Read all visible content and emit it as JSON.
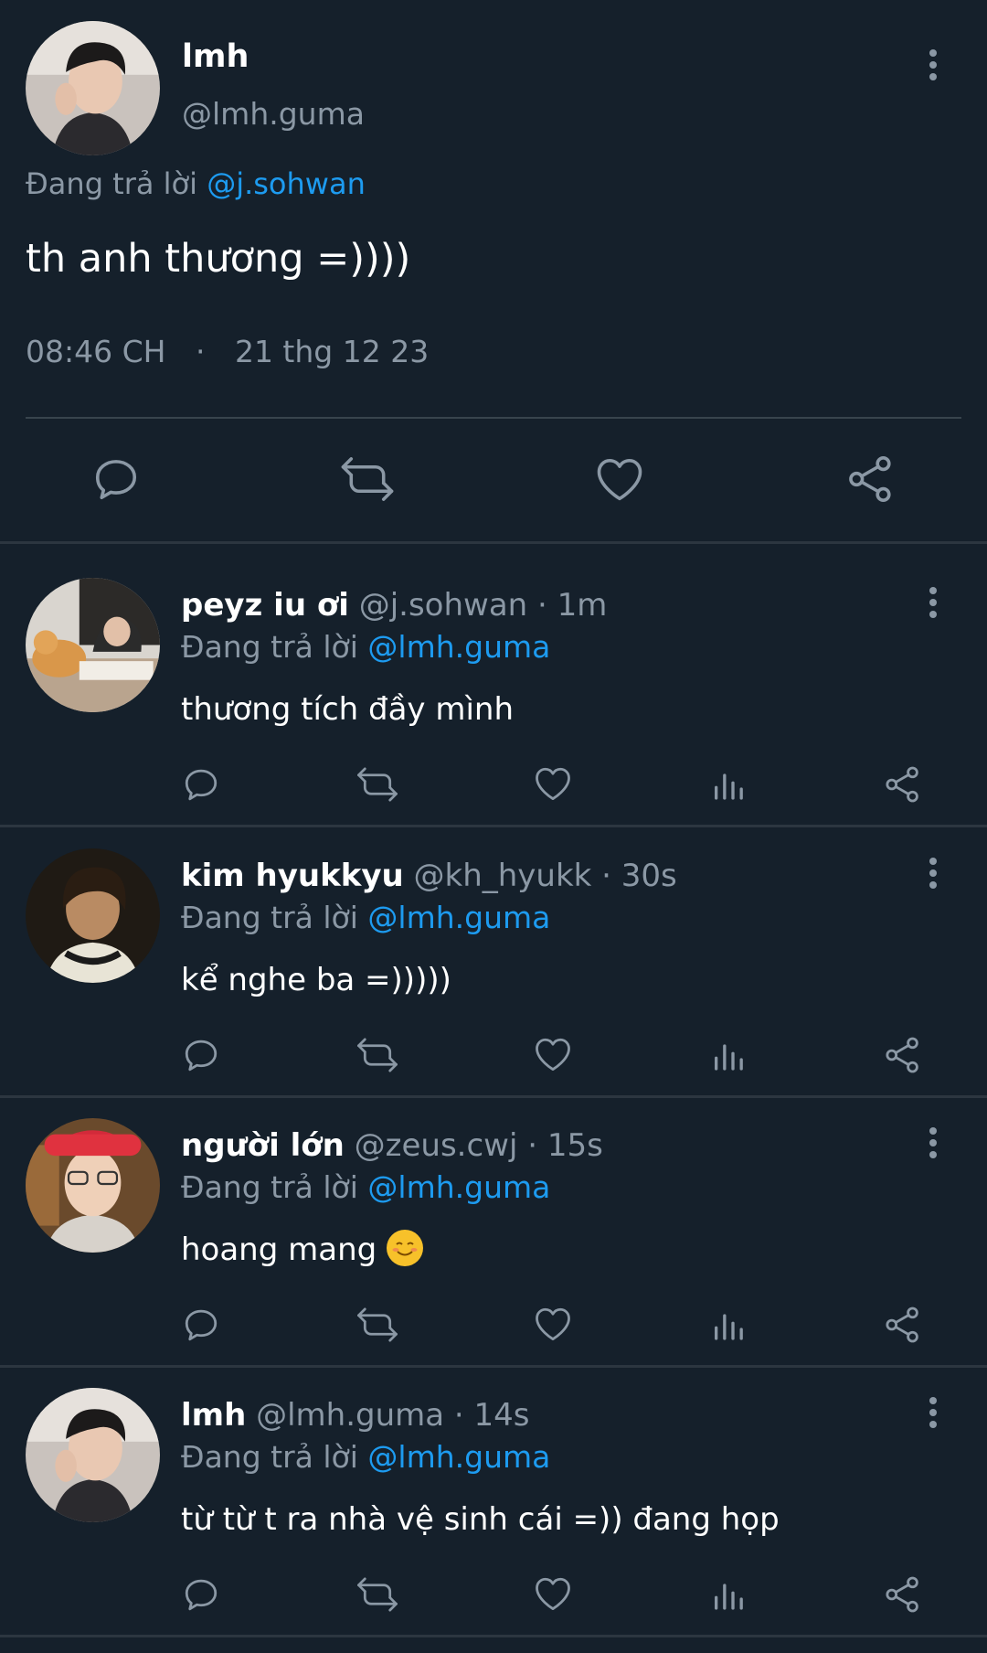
{
  "main_tweet": {
    "name": "lmh",
    "handle": "@lmh.guma",
    "reply_prefix": "Đang trả lời",
    "reply_to": "@j.sohwan",
    "text": "th anh thương =))))",
    "time": "08:46 CH",
    "dot": "·",
    "date": "21 thg 12 23",
    "actions": [
      "reply-icon",
      "retweet-icon",
      "like-icon",
      "share-icon"
    ]
  },
  "replies": [
    {
      "name": "peyz iu ơi",
      "handle": "@j.sohwan · 1m",
      "reply_prefix": "Đang trả lời",
      "reply_to": "@lmh.guma",
      "text": "thương tích đầy mình",
      "emoji": ""
    },
    {
      "name": "kim hyukkyu",
      "handle": "@kh_hyukk · 30s",
      "reply_prefix": "Đang trả lời",
      "reply_to": "@lmh.guma",
      "text": "kể nghe ba =)))))",
      "emoji": ""
    },
    {
      "name": "người lớn",
      "handle": "@zeus.cwj · 15s",
      "reply_prefix": "Đang trả lời",
      "reply_to": "@lmh.guma",
      "text": "hoang mang",
      "emoji": "smiling-face-emoji"
    },
    {
      "name": "lmh",
      "handle": "@lmh.guma · 14s",
      "reply_prefix": "Đang trả lời",
      "reply_to": "@lmh.guma",
      "text": "từ từ t ra nhà vệ sinh cái =)) đang họp",
      "emoji": ""
    }
  ],
  "reply_actions": [
    "reply-icon",
    "retweet-icon",
    "like-icon",
    "views-icon",
    "share-icon"
  ],
  "colors": {
    "background": "#15202b",
    "text_primary": "#ffffff",
    "text_secondary": "#8b98a5",
    "link": "#1d9bf0",
    "divider": "#38444d"
  }
}
